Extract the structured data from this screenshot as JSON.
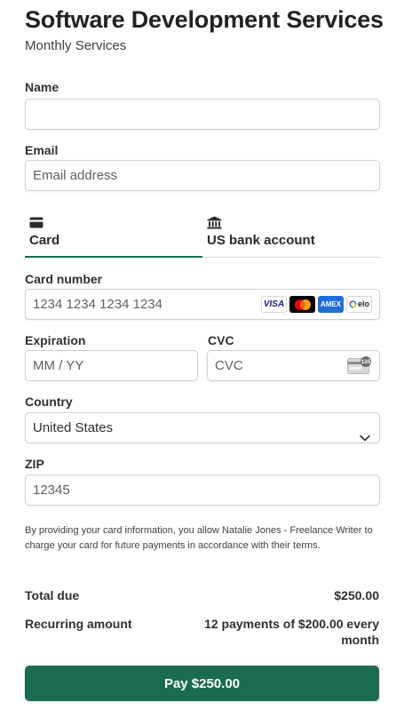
{
  "header": {
    "title": "Software Development Services",
    "subtitle": "Monthly Services"
  },
  "form": {
    "name": {
      "label": "Name",
      "value": ""
    },
    "email": {
      "label": "Email",
      "placeholder": "Email address"
    },
    "tabs": [
      {
        "label": "Card",
        "icon": "credit-card-icon",
        "selected": true
      },
      {
        "label": "US bank account",
        "icon": "bank-icon",
        "selected": false
      }
    ],
    "card_number": {
      "label": "Card number",
      "placeholder": "1234 1234 1234 1234"
    },
    "card_brands": [
      "VISA",
      "mastercard",
      "AMEX",
      "elo"
    ],
    "expiration": {
      "label": "Expiration",
      "placeholder": "MM / YY"
    },
    "cvc": {
      "label": "CVC",
      "placeholder": "CVC",
      "icon_text": "135"
    },
    "country": {
      "label": "Country",
      "value": "United States"
    },
    "zip": {
      "label": "ZIP",
      "placeholder": "12345"
    }
  },
  "disclaimer": "By providing your card information, you allow Natalie Jones - Freelance Writer to charge your card for future payments in accordance with their terms.",
  "summary": {
    "total_label": "Total due",
    "total_value": "$250.00",
    "recurring_label": "Recurring amount",
    "recurring_value": "12 payments of $200.00 every month"
  },
  "pay_button": {
    "label": "Pay $250.00"
  },
  "colors": {
    "accent": "#1a6b50",
    "border": "#cfcfcf",
    "amex": "#1e6ed8"
  }
}
